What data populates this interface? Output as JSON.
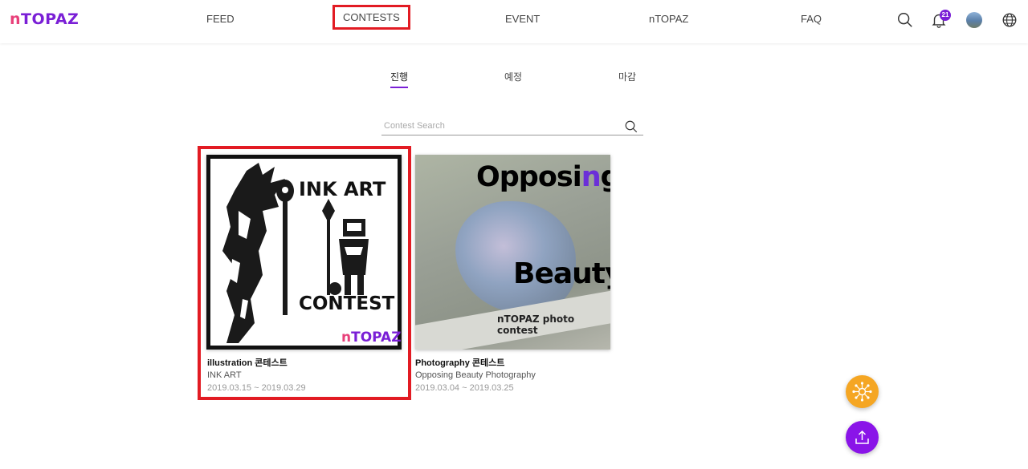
{
  "header": {
    "logo_n": "n",
    "logo_rest": "TOPAZ",
    "nav": [
      "FEED",
      "CONTESTS",
      "EVENT",
      "nTOPAZ",
      "FAQ"
    ],
    "notification_count": "21"
  },
  "tabs": [
    "진행",
    "예정",
    "마감"
  ],
  "search": {
    "placeholder": "Contest Search"
  },
  "cards": [
    {
      "title": "illustration 콘테스트",
      "subtitle": "INK ART",
      "date": "2019.03.15 ~ 2019.03.29",
      "image_text": {
        "line1": "INK ART",
        "line2": "CONTEST",
        "logo_n": "n",
        "logo_rest": "TOPAZ"
      }
    },
    {
      "title": "Photography 콘테스트",
      "subtitle": "Opposing Beauty Photography",
      "date": "2019.03.04 ~ 2019.03.25",
      "image_text": {
        "line1_a": "Opposi",
        "line1_b": "n",
        "line1_c": "g",
        "line2": "Beauty",
        "caption": "nTOPAZ photo contest"
      }
    }
  ],
  "colors": {
    "accent": "#7a1fd6",
    "highlight": "#e21b23",
    "fab_orange": "#f5a623",
    "fab_purple": "#8a14e8"
  }
}
